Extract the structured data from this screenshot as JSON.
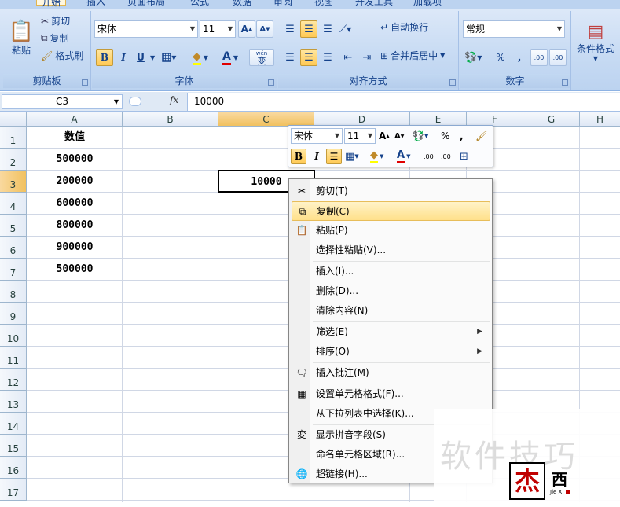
{
  "ribbon_tabs": [
    "开始",
    "插入",
    "页面布局",
    "公式",
    "数据",
    "审阅",
    "视图",
    "开发工具",
    "加载项"
  ],
  "clipboard": {
    "paste": "粘贴",
    "cut": "剪切",
    "copy": "复制",
    "format_painter": "格式刷",
    "title": "剪贴板"
  },
  "font": {
    "name": "宋体",
    "size": "11",
    "bold": "B",
    "italic": "I",
    "underline": "U",
    "grow": "A",
    "shrink": "A",
    "phonetic": "wén",
    "phonetic_char": "变",
    "title": "字体"
  },
  "alignment": {
    "wrap": "自动换行",
    "merge": "合并后居中",
    "title": "对齐方式"
  },
  "number": {
    "format": "常规",
    "percent": "%",
    "comma": ",",
    "inc_dec": ".00",
    "dec_dec": ".00",
    "title": "数字"
  },
  "styles": {
    "conditional": "条件格式"
  },
  "formula_bar": {
    "name_box": "C3",
    "fx": "fx",
    "value": "10000"
  },
  "columns": [
    "A",
    "B",
    "C",
    "D",
    "E",
    "F",
    "G",
    "H"
  ],
  "rows": [
    "1",
    "2",
    "3",
    "4",
    "5",
    "6",
    "7",
    "8",
    "9",
    "10",
    "11",
    "12",
    "13",
    "14",
    "15",
    "16",
    "17"
  ],
  "cells": {
    "A1": "数值",
    "A2": "500000",
    "A3": "200000",
    "A4": "600000",
    "A5": "800000",
    "A6": "900000",
    "A7": "500000",
    "C3": "10000"
  },
  "mini_toolbar": {
    "font": "宋体",
    "size": "11",
    "grow": "A",
    "shrink": "A",
    "percent": "%",
    "comma": ",",
    "bold": "B",
    "italic": "I",
    "inc": ".00",
    "dec": ".00"
  },
  "context_menu": [
    {
      "label": "剪切(T)",
      "icon": "scissors-icon"
    },
    {
      "label": "复制(C)",
      "icon": "copy-icon"
    },
    {
      "label": "粘贴(P)",
      "icon": "paste-icon"
    },
    {
      "label": "选择性粘贴(V)...",
      "icon": ""
    },
    {
      "label": "插入(I)...",
      "icon": ""
    },
    {
      "label": "删除(D)...",
      "icon": ""
    },
    {
      "label": "清除内容(N)",
      "icon": ""
    },
    {
      "label": "筛选(E)",
      "icon": ""
    },
    {
      "label": "排序(O)",
      "icon": ""
    },
    {
      "label": "插入批注(M)",
      "icon": "comment-icon"
    },
    {
      "label": "设置单元格格式(F)...",
      "icon": "format-cells-icon"
    },
    {
      "label": "从下拉列表中选择(K)...",
      "icon": ""
    },
    {
      "label": "显示拼音字段(S)",
      "icon": "phonetic-icon"
    },
    {
      "label": "命名单元格区域(R)...",
      "icon": ""
    },
    {
      "label": "超链接(H)...",
      "icon": "hyperlink-icon"
    }
  ],
  "watermark": {
    "text": "软件技巧",
    "logo_char": "杰",
    "logo_char2": "西",
    "logo_sub": "Jie Xi"
  },
  "colors": {
    "ribbon": "#c6daf3",
    "selected_header": "#f1c15f",
    "menu_highlight": "#ffe08a",
    "accent_red": "#c00000"
  }
}
